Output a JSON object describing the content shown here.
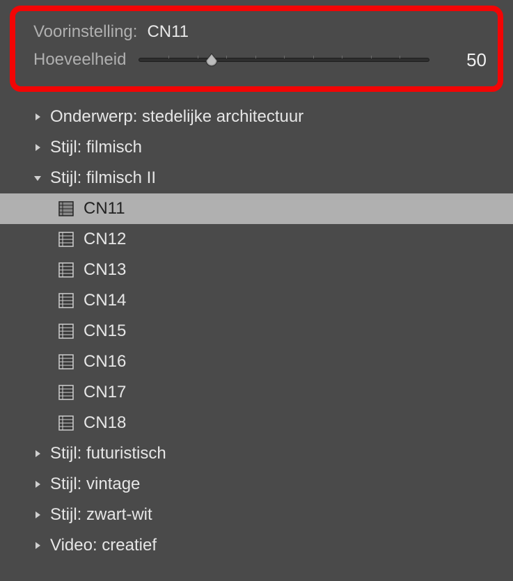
{
  "header": {
    "preset_label": "Voorinstelling:",
    "preset_value": "CN11",
    "amount_label": "Hoeveelheid",
    "amount_value": "50",
    "slider_percent": 25
  },
  "tree": {
    "groups": [
      {
        "label": "Onderwerp: stedelijke architectuur",
        "expanded": false,
        "children": []
      },
      {
        "label": "Stijl: filmisch",
        "expanded": false,
        "children": []
      },
      {
        "label": "Stijl: filmisch II",
        "expanded": true,
        "children": [
          {
            "label": "CN11",
            "selected": true
          },
          {
            "label": "CN12",
            "selected": false
          },
          {
            "label": "CN13",
            "selected": false
          },
          {
            "label": "CN14",
            "selected": false
          },
          {
            "label": "CN15",
            "selected": false
          },
          {
            "label": "CN16",
            "selected": false
          },
          {
            "label": "CN17",
            "selected": false
          },
          {
            "label": "CN18",
            "selected": false
          }
        ]
      },
      {
        "label": "Stijl: futuristisch",
        "expanded": false,
        "children": []
      },
      {
        "label": "Stijl: vintage",
        "expanded": false,
        "children": []
      },
      {
        "label": "Stijl: zwart-wit",
        "expanded": false,
        "children": []
      },
      {
        "label": "Video: creatief",
        "expanded": false,
        "children": []
      }
    ]
  }
}
